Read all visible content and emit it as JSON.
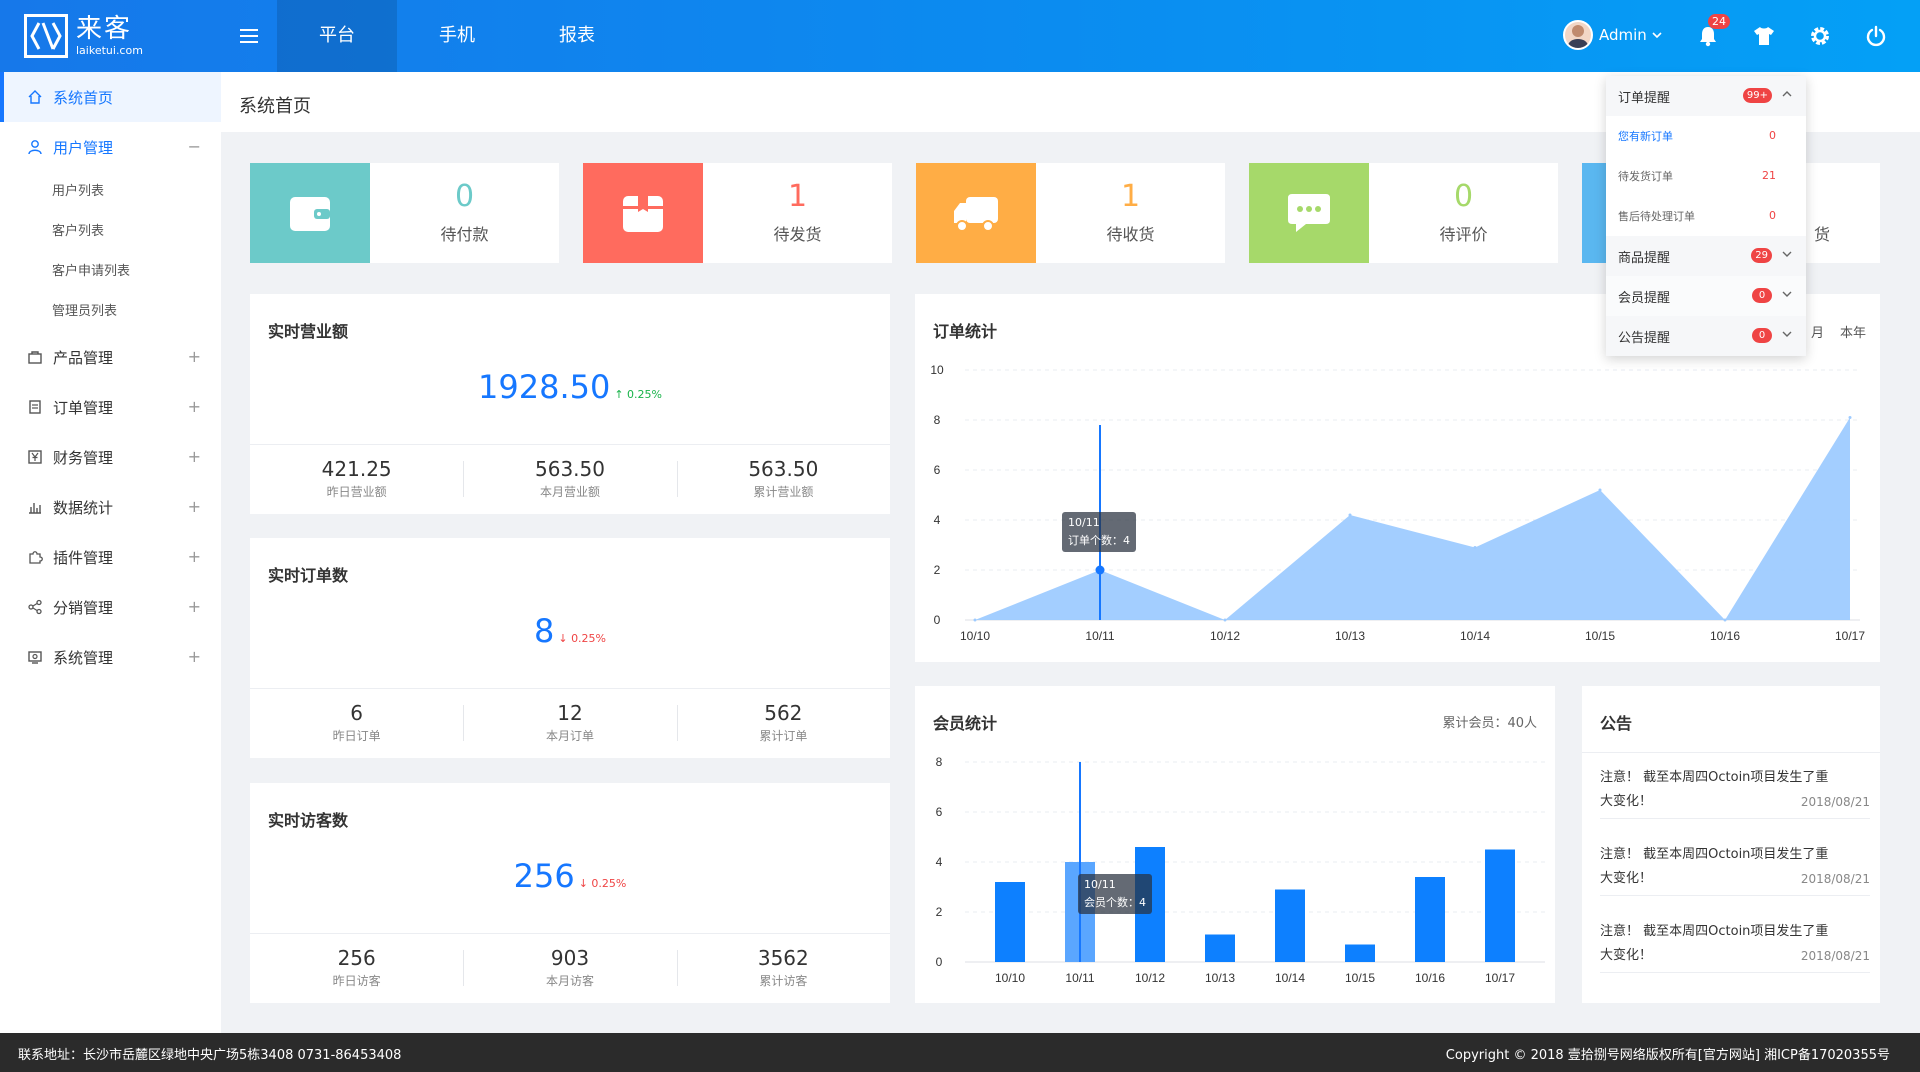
{
  "brand": {
    "name": "来客",
    "domain": "laiketui.com"
  },
  "top_tabs": [
    {
      "label": "平台"
    },
    {
      "label": "手机"
    },
    {
      "label": "报表"
    }
  ],
  "user": {
    "name": "Admin",
    "notification_count": "24"
  },
  "sidebar": {
    "items": [
      {
        "label": "系统首页",
        "icon": "home-icon",
        "sign": ""
      },
      {
        "label": "用户管理",
        "icon": "user-icon",
        "sign": "−"
      },
      {
        "label": "产品管理",
        "icon": "bag-icon",
        "sign": "+"
      },
      {
        "label": "订单管理",
        "icon": "document-icon",
        "sign": "+"
      },
      {
        "label": "财务管理",
        "icon": "yen-icon",
        "sign": "+"
      },
      {
        "label": "数据统计",
        "icon": "bar-chart-icon",
        "sign": "+"
      },
      {
        "label": "插件管理",
        "icon": "puzzle-icon",
        "sign": "+"
      },
      {
        "label": "分销管理",
        "icon": "share-icon",
        "sign": "+"
      },
      {
        "label": "系统管理",
        "icon": "monitor-icon",
        "sign": "+"
      }
    ],
    "user_submenu": [
      "用户列表",
      "客户列表",
      "客户申请列表",
      "管理员列表"
    ]
  },
  "page_title": "系统首页",
  "stat_cards": [
    {
      "value": "0",
      "label": "待付款",
      "color": "#6ccac9",
      "icon": "wallet-icon"
    },
    {
      "value": "1",
      "label": "待发货",
      "color": "#ff6b5e",
      "icon": "package-icon"
    },
    {
      "value": "1",
      "label": "待收货",
      "color": "#ffad45",
      "icon": "truck-icon"
    },
    {
      "value": "0",
      "label": "待评价",
      "color": "#a6d96a",
      "icon": "comment-icon"
    },
    {
      "value": "",
      "label": "货",
      "color": "#5ab7f0",
      "icon": ""
    }
  ],
  "revenue": {
    "title": "实时营业额",
    "value": "1928.50",
    "change": "0.25%",
    "stats": [
      {
        "value": "421.25",
        "label": "昨日营业额"
      },
      {
        "value": "563.50",
        "label": "本月营业额"
      },
      {
        "value": "563.50",
        "label": "累计营业额"
      }
    ]
  },
  "orders": {
    "title": "实时订单数",
    "value": "8",
    "change": "0.25%",
    "stats": [
      {
        "value": "6",
        "label": "昨日订单"
      },
      {
        "value": "12",
        "label": "本月订单"
      },
      {
        "value": "562",
        "label": "累计订单"
      }
    ]
  },
  "visitors": {
    "title": "实时访客数",
    "value": "256",
    "change": "0.25%",
    "stats": [
      {
        "value": "256",
        "label": "昨日访客"
      },
      {
        "value": "903",
        "label": "本月访客"
      },
      {
        "value": "3562",
        "label": "累计访客"
      }
    ]
  },
  "order_chart": {
    "title": "订单统计",
    "range_options": [
      "月",
      "本年"
    ],
    "tooltip": {
      "date": "10/11",
      "text": "订单个数：4"
    }
  },
  "member_chart": {
    "title": "会员统计",
    "total": "累计会员：40人",
    "tooltip": {
      "date": "10/11",
      "text": "会员个数：4"
    }
  },
  "notices": {
    "title": "公告",
    "items": [
      {
        "line1": "注意！ 截至本周四Octoin项目发生了重",
        "line2": "大变化！",
        "date": "2018/08/21"
      },
      {
        "line1": "注意！ 截至本周四Octoin项目发生了重",
        "line2": "大变化！",
        "date": "2018/08/21"
      },
      {
        "line1": "注意！ 截至本周四Octoin项目发生了重",
        "line2": "大变化！",
        "date": "2018/08/21"
      }
    ]
  },
  "dropdown": {
    "order_group": {
      "label": "订单提醒",
      "badge": "99+"
    },
    "order_rows": [
      {
        "label": "您有新订单",
        "count": "0"
      },
      {
        "label": "待发货订单",
        "count": "21"
      },
      {
        "label": "售后待处理订单",
        "count": "0"
      }
    ],
    "groups": [
      {
        "label": "商品提醒",
        "badge": "29"
      },
      {
        "label": "会员提醒",
        "badge": "0"
      },
      {
        "label": "公告提醒",
        "badge": "0"
      }
    ]
  },
  "footer": {
    "address": "联系地址：长沙市岳麓区绿地中央广场5栋3408 0731-86453408",
    "copyright": "Copyright © 2018 壹拾捌号网络版权所有[官方网站]  湘ICP备17020355号"
  },
  "chart_data": [
    {
      "type": "area",
      "title": "订单统计",
      "x": [
        "10/10",
        "10/11",
        "10/12",
        "10/13",
        "10/14",
        "10/15",
        "10/16",
        "10/17"
      ],
      "series": [
        {
          "values": [
            0,
            2,
            0,
            4.2,
            2.9,
            5.2,
            0,
            8.1
          ]
        }
      ],
      "ylim": [
        0,
        10
      ],
      "yticks": [
        0,
        2,
        4,
        6,
        8,
        10
      ],
      "grid": true,
      "color": "#9ecbff"
    },
    {
      "type": "bar",
      "title": "会员统计",
      "categories": [
        "10/10",
        "10/11",
        "10/12",
        "10/13",
        "10/14",
        "10/15",
        "10/16",
        "10/17"
      ],
      "values": [
        3.2,
        4,
        4.6,
        1.1,
        2.9,
        0.7,
        3.4,
        4.5
      ],
      "ylim": [
        0,
        8
      ],
      "yticks": [
        0,
        2,
        4,
        6,
        8
      ],
      "grid": true,
      "color": "#0d80ff",
      "highlight_color": "#5aa6ff",
      "highlight_index": 1
    }
  ]
}
